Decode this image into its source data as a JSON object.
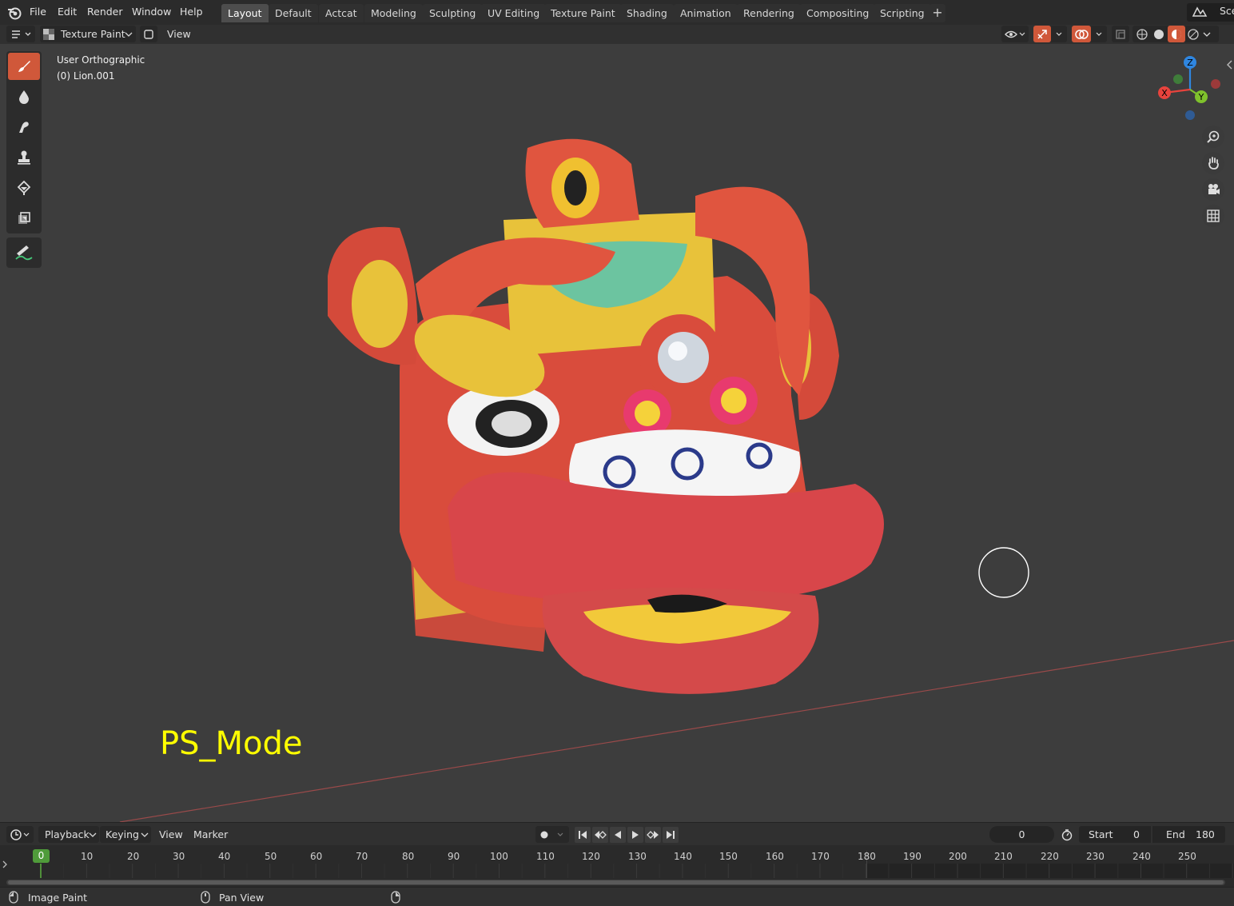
{
  "menu": {
    "items": [
      "File",
      "Edit",
      "Render",
      "Window",
      "Help"
    ]
  },
  "workspaces": {
    "tabs": [
      "Layout",
      "Default",
      "Actcat",
      "Modeling",
      "Sculpting",
      "UV Editing",
      "Texture Paint",
      "Shading",
      "Animation",
      "Rendering",
      "Compositing",
      "Scripting"
    ],
    "active": "Layout",
    "add_label": "+"
  },
  "scene": {
    "label": "Sce"
  },
  "viewport_header": {
    "mode_label": "Texture Paint",
    "view_label": "View"
  },
  "viewport": {
    "title": "User Orthographic",
    "object": "(0) Lion.001",
    "overlay_text": "PS_Mode",
    "gizmo": {
      "x": "X",
      "y": "Y",
      "z": "Z"
    },
    "colors": {
      "overlay_text": "#ffff00",
      "active_tool": "#d0583a",
      "x_axis": "#e8433d",
      "y_axis": "#7fc22c",
      "z_axis": "#2f86e0"
    }
  },
  "toolbar": {
    "tools": [
      "brush-tool",
      "soften-tool",
      "smear-tool",
      "clone-tool",
      "fill-tool",
      "mask-tool"
    ],
    "annotate": "annotate-tool"
  },
  "timeline": {
    "menus": [
      "Playback",
      "Keying",
      "View",
      "Marker"
    ],
    "current_frame": "0",
    "start_label": "Start",
    "start_value": "0",
    "end_label": "End",
    "end_value": "180",
    "ticks": [
      "0",
      "10",
      "20",
      "30",
      "40",
      "50",
      "60",
      "70",
      "80",
      "90",
      "100",
      "110",
      "120",
      "130",
      "140",
      "150",
      "160",
      "170",
      "180",
      "190",
      "200",
      "210",
      "220",
      "230",
      "240",
      "250"
    ]
  },
  "statusbar": {
    "left_action": "Image Paint",
    "middle_action": "Pan View"
  }
}
